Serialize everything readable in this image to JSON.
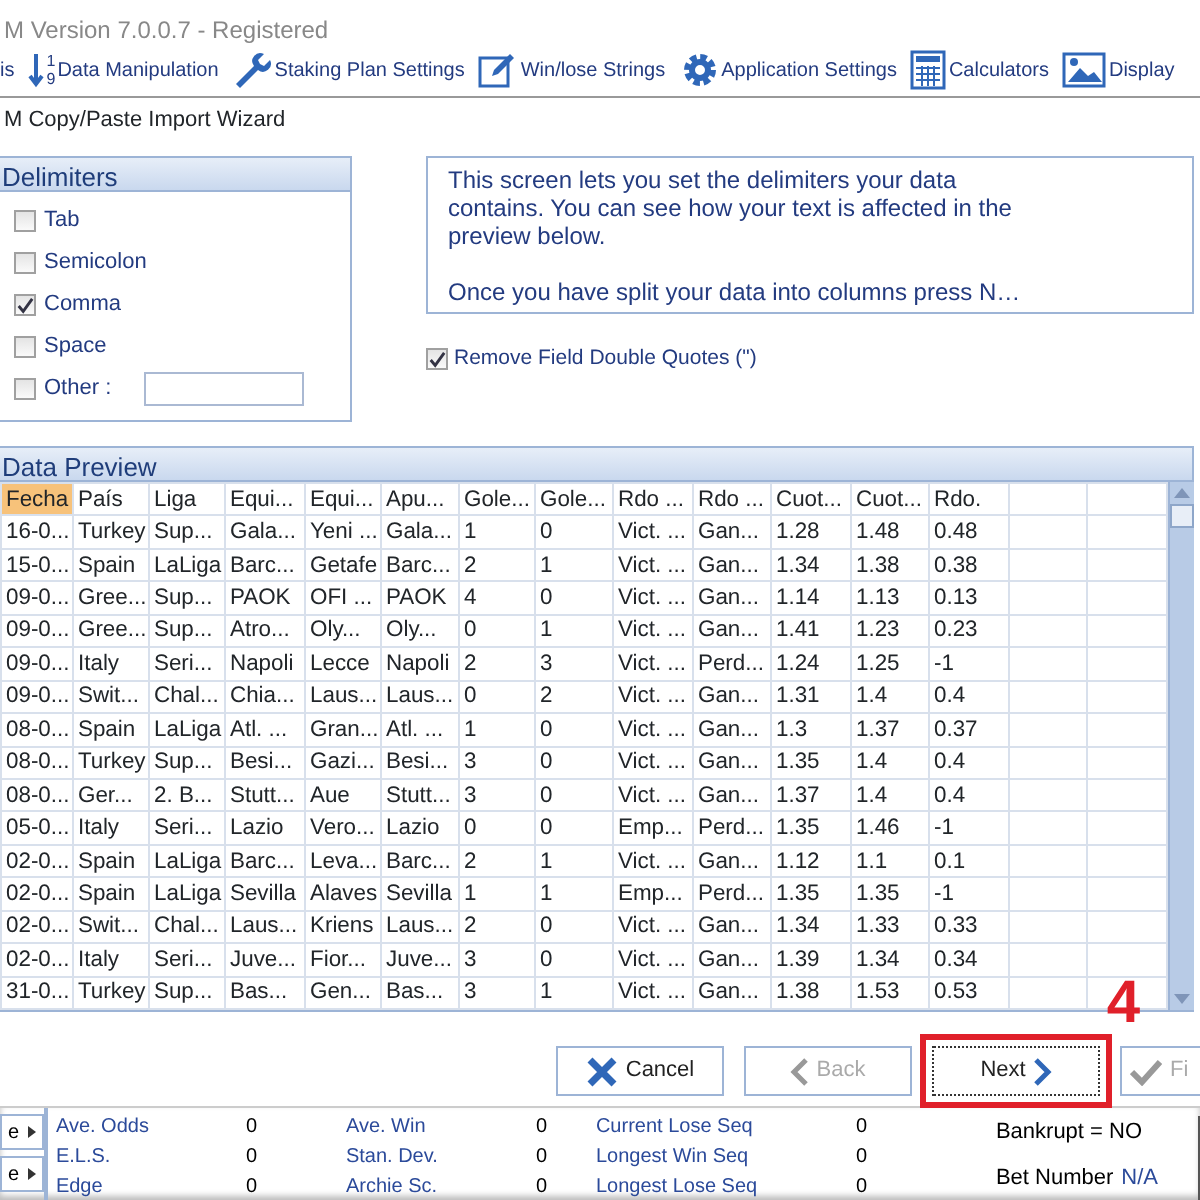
{
  "window": {
    "title": "M Version 7.0.0.7 - Registered"
  },
  "toolbar": [
    {
      "label": "is",
      "kind": "plain"
    },
    {
      "label": "Data Manipulation",
      "kind": "sort",
      "icon_text": [
        "1",
        "9"
      ]
    },
    {
      "label": "Staking Plan Settings",
      "kind": "wrench"
    },
    {
      "label": "Win/lose Strings",
      "kind": "pencil"
    },
    {
      "label": "Application Settings",
      "kind": "gear"
    },
    {
      "label": "Calculators",
      "kind": "calculator"
    },
    {
      "label": "Display",
      "kind": "picture"
    }
  ],
  "wizard": {
    "title": "M Copy/Paste Import Wizard",
    "delimiters": {
      "title": "Delimiters",
      "options": [
        {
          "label": "Tab",
          "checked": false
        },
        {
          "label": "Semicolon",
          "checked": false
        },
        {
          "label": "Comma",
          "checked": true
        },
        {
          "label": "Space",
          "checked": false
        },
        {
          "label": "Other :",
          "checked": false,
          "kind": "with_field"
        }
      ]
    },
    "info": [
      "This screen lets you set the delimiters your data contains. You can see how your text is affected in the preview below.",
      "Once you have split your data into columns press N…"
    ],
    "remove_quotes": {
      "label": "Remove Field Double Quotes (\")",
      "checked": true
    },
    "preview": {
      "title": "Data Preview",
      "columns": [
        {
          "label": "Fecha",
          "selected": true
        },
        {
          "label": "País",
          "selected": false
        },
        {
          "label": "Liga",
          "selected": false
        },
        {
          "label": "Equi...",
          "selected": false
        },
        {
          "label": "Equi...",
          "selected": false
        },
        {
          "label": "Apu...",
          "selected": false
        },
        {
          "label": "Gole...",
          "selected": false
        },
        {
          "label": "Gole...",
          "selected": false
        },
        {
          "label": "Rdo ...",
          "selected": false
        },
        {
          "label": "Rdo ...",
          "selected": false
        },
        {
          "label": "Cuot...",
          "selected": false
        },
        {
          "label": "Cuot...",
          "selected": false
        },
        {
          "label": "Rdo.",
          "selected": false
        }
      ],
      "rows": [
        [
          "16-0...",
          "Turkey",
          "Sup...",
          "Gala...",
          "Yeni ...",
          "Gala...",
          "1",
          "0",
          "Vict. ...",
          "Gan...",
          "1.28",
          "1.48",
          "0.48"
        ],
        [
          "15-0...",
          "Spain",
          "LaLiga",
          "Barc...",
          "Getafe",
          "Barc...",
          "2",
          "1",
          "Vict. ...",
          "Gan...",
          "1.34",
          "1.38",
          "0.38"
        ],
        [
          "09-0...",
          "Gree...",
          "Sup...",
          "PAOK",
          "OFI ...",
          "PAOK",
          "4",
          "0",
          "Vict. ...",
          "Gan...",
          "1.14",
          "1.13",
          "0.13"
        ],
        [
          "09-0...",
          "Gree...",
          "Sup...",
          "Atro...",
          "Oly...",
          "Oly...",
          "0",
          "1",
          "Vict. ...",
          "Gan...",
          "1.41",
          "1.23",
          "0.23"
        ],
        [
          "09-0...",
          "Italy",
          "Seri...",
          "Napoli",
          "Lecce",
          "Napoli",
          "2",
          "3",
          "Vict. ...",
          "Perd...",
          "1.24",
          "1.25",
          "-1"
        ],
        [
          "09-0...",
          "Swit...",
          "Chal...",
          "Chia...",
          "Laus...",
          "Laus...",
          "0",
          "2",
          "Vict. ...",
          "Gan...",
          "1.31",
          "1.4",
          "0.4"
        ],
        [
          "08-0...",
          "Spain",
          "LaLiga",
          "Atl. ...",
          "Gran...",
          "Atl. ...",
          "1",
          "0",
          "Vict. ...",
          "Gan...",
          "1.3",
          "1.37",
          "0.37"
        ],
        [
          "08-0...",
          "Turkey",
          "Sup...",
          "Besi...",
          "Gazi...",
          "Besi...",
          "3",
          "0",
          "Vict. ...",
          "Gan...",
          "1.35",
          "1.4",
          "0.4"
        ],
        [
          "08-0...",
          "Ger...",
          "2. B...",
          "Stutt...",
          "Aue",
          "Stutt...",
          "3",
          "0",
          "Vict. ...",
          "Gan...",
          "1.37",
          "1.4",
          "0.4"
        ],
        [
          "05-0...",
          "Italy",
          "Seri...",
          "Lazio",
          "Vero...",
          "Lazio",
          "0",
          "0",
          "Emp...",
          "Perd...",
          "1.35",
          "1.46",
          "-1"
        ],
        [
          "02-0...",
          "Spain",
          "LaLiga",
          "Barc...",
          "Leva...",
          "Barc...",
          "2",
          "1",
          "Vict. ...",
          "Gan...",
          "1.12",
          "1.1",
          "0.1"
        ],
        [
          "02-0...",
          "Spain",
          "LaLiga",
          "Sevilla",
          "Alaves",
          "Sevilla",
          "1",
          "1",
          "Emp...",
          "Perd...",
          "1.35",
          "1.35",
          "-1"
        ],
        [
          "02-0...",
          "Swit...",
          "Chal...",
          "Laus...",
          "Kriens",
          "Laus...",
          "2",
          "0",
          "Vict. ...",
          "Gan...",
          "1.34",
          "1.33",
          "0.33"
        ],
        [
          "02-0...",
          "Italy",
          "Seri...",
          "Juve...",
          "Fior...",
          "Juve...",
          "3",
          "0",
          "Vict. ...",
          "Gan...",
          "1.39",
          "1.34",
          "0.34"
        ],
        [
          "31-0...",
          "Turkey",
          "Sup...",
          "Bas...",
          "Gen...",
          "Bas...",
          "3",
          "1",
          "Vict. ...",
          "Gan...",
          "1.38",
          "1.53",
          "0.53"
        ]
      ]
    },
    "buttons": [
      {
        "label": "Cancel",
        "kind": "cancel",
        "disabled": false,
        "highlighted": false
      },
      {
        "label": "Back",
        "kind": "back",
        "disabled": true,
        "highlighted": false
      },
      {
        "label": "Next",
        "kind": "next",
        "disabled": false,
        "highlighted": true
      },
      {
        "label": "Fi",
        "kind": "finish",
        "disabled": true,
        "highlighted": false
      }
    ],
    "step_annotation": "4"
  },
  "stats_panel": {
    "side_buttons": [
      "e",
      "e"
    ],
    "stats": [
      {
        "label": "Ave. Odds",
        "value": "0"
      },
      {
        "label": "Ave. Win",
        "value": "0"
      },
      {
        "label": "Current Lose Seq",
        "value": "0"
      },
      {
        "label": "E.L.S.",
        "value": "0"
      },
      {
        "label": "Stan. Dev.",
        "value": "0"
      },
      {
        "label": "Longest Win Seq",
        "value": "0"
      },
      {
        "label": "Edge",
        "value": "0"
      },
      {
        "label": "Archie Sc.",
        "value": "0"
      },
      {
        "label": "Longest Lose Seq",
        "value": "0"
      }
    ],
    "bankrupt": "Bankrupt = NO",
    "bet_number": {
      "label": "Bet Number",
      "value": "N/A"
    }
  }
}
